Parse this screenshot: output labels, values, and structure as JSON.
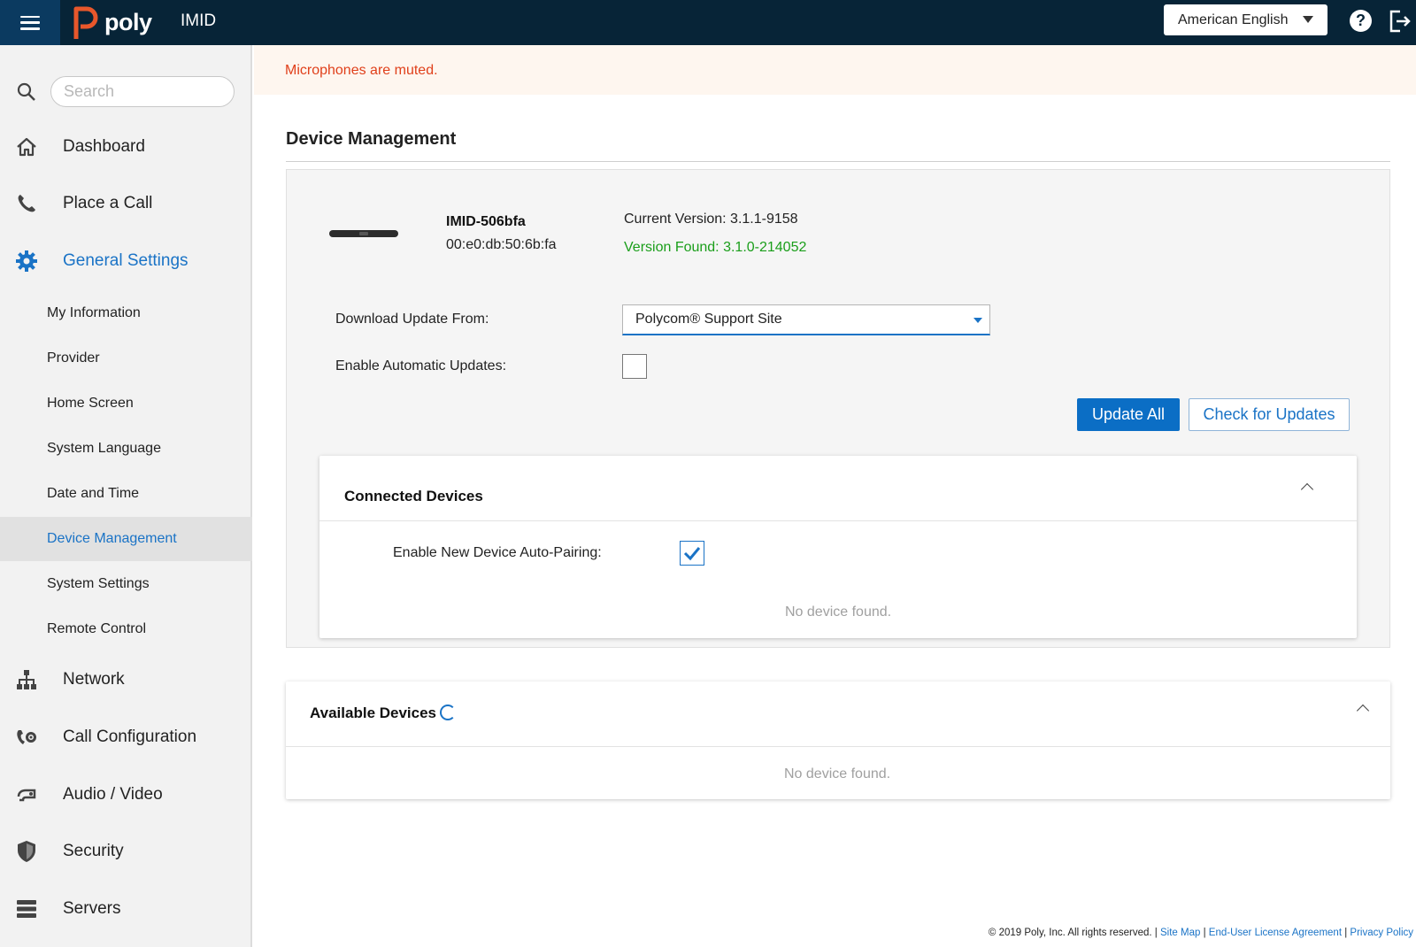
{
  "header": {
    "device_name": "IMID",
    "logo_text": "poly",
    "language": "American English",
    "help_symbol": "?"
  },
  "sidebar": {
    "search_placeholder": "Search",
    "items": [
      {
        "label": "Dashboard",
        "icon": "home-icon"
      },
      {
        "label": "Place a Call",
        "icon": "phone-icon"
      },
      {
        "label": "General Settings",
        "icon": "gear-icon",
        "active": true
      }
    ],
    "subitems": [
      {
        "label": "My Information"
      },
      {
        "label": "Provider"
      },
      {
        "label": "Home Screen"
      },
      {
        "label": "System Language"
      },
      {
        "label": "Date and Time"
      },
      {
        "label": "Device Management",
        "active": true
      },
      {
        "label": "System Settings"
      },
      {
        "label": "Remote Control"
      }
    ],
    "items_after": [
      {
        "label": "Network",
        "icon": "network-icon"
      },
      {
        "label": "Call Configuration",
        "icon": "call-config-icon"
      },
      {
        "label": "Audio / Video",
        "icon": "camera-icon"
      },
      {
        "label": "Security",
        "icon": "shield-icon"
      },
      {
        "label": "Servers",
        "icon": "server-icon"
      }
    ]
  },
  "alert": {
    "text": "Microphones are muted."
  },
  "main": {
    "title": "Device Management",
    "device": {
      "name": "IMID-506bfa",
      "mac": "00:e0:db:50:6b:fa",
      "current_version": "Current Version: 3.1.1-9158",
      "version_found": "Version Found: 3.1.0-214052"
    },
    "download_label": "Download Update From:",
    "download_value": "Polycom® Support Site",
    "auto_updates_label": "Enable Automatic Updates:",
    "auto_updates_checked": false,
    "update_all_label": "Update All",
    "check_updates_label": "Check for Updates",
    "connected": {
      "title": "Connected Devices",
      "auto_pair_label": "Enable New Device Auto-Pairing:",
      "auto_pair_checked": true,
      "empty_text": "No device found."
    },
    "available": {
      "title": "Available Devices",
      "empty_text": "No device found."
    }
  },
  "footer": {
    "copyright": "© 2019 Poly, Inc. All rights reserved. |",
    "site_map": "Site Map",
    "eula": "End-User License Agreement",
    "privacy": "Privacy Policy",
    "sep": "|"
  },
  "colors": {
    "topbar": "#072437",
    "accent": "#1a73c6",
    "alert_text": "#e0401b",
    "success": "#1a9e1a",
    "logo_mark": "#e8572b"
  }
}
